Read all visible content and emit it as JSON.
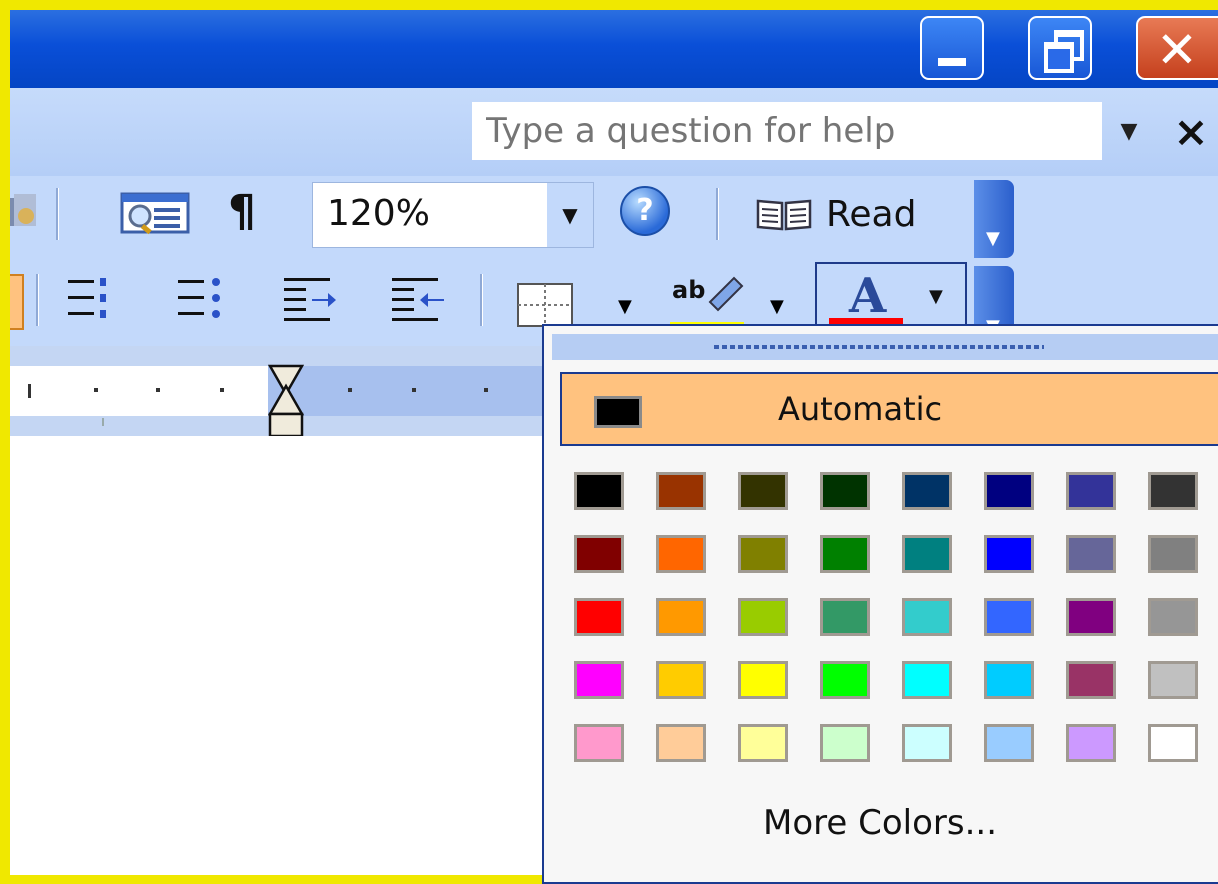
{
  "window": {
    "minimize_icon": "minimize-icon",
    "maximize_icon": "restore-icon",
    "close_icon": "close-icon"
  },
  "help": {
    "placeholder": "Type a question for help",
    "close_glyph": "×"
  },
  "standard_toolbar": {
    "pilcrow": "¶",
    "zoom_value": "120%",
    "read_label": "Read"
  },
  "font_color_menu": {
    "automatic_label": "Automatic",
    "more_colors_label": "More Colors...",
    "palette": [
      [
        "#000000",
        "#993300",
        "#333300",
        "#003300",
        "#003366",
        "#000080",
        "#333399",
        "#333333"
      ],
      [
        "#800000",
        "#FF6600",
        "#808000",
        "#008000",
        "#008080",
        "#0000FF",
        "#666699",
        "#808080"
      ],
      [
        "#FF0000",
        "#FF9900",
        "#99CC00",
        "#339966",
        "#33CCCC",
        "#3366FF",
        "#800080",
        "#969696"
      ],
      [
        "#FF00FF",
        "#FFCC00",
        "#FFFF00",
        "#00FF00",
        "#00FFFF",
        "#00CCFF",
        "#993366",
        "#C0C0C0"
      ],
      [
        "#FF99CC",
        "#FFCC99",
        "#FFFF99",
        "#CCFFCC",
        "#CCFFFF",
        "#99CCFF",
        "#CC99FF",
        "#FFFFFF"
      ]
    ]
  },
  "colors": {
    "highlight_bar": "#FFFF00",
    "font_color_bar": "#FF0000",
    "automatic_hover": "#FFC27F"
  }
}
